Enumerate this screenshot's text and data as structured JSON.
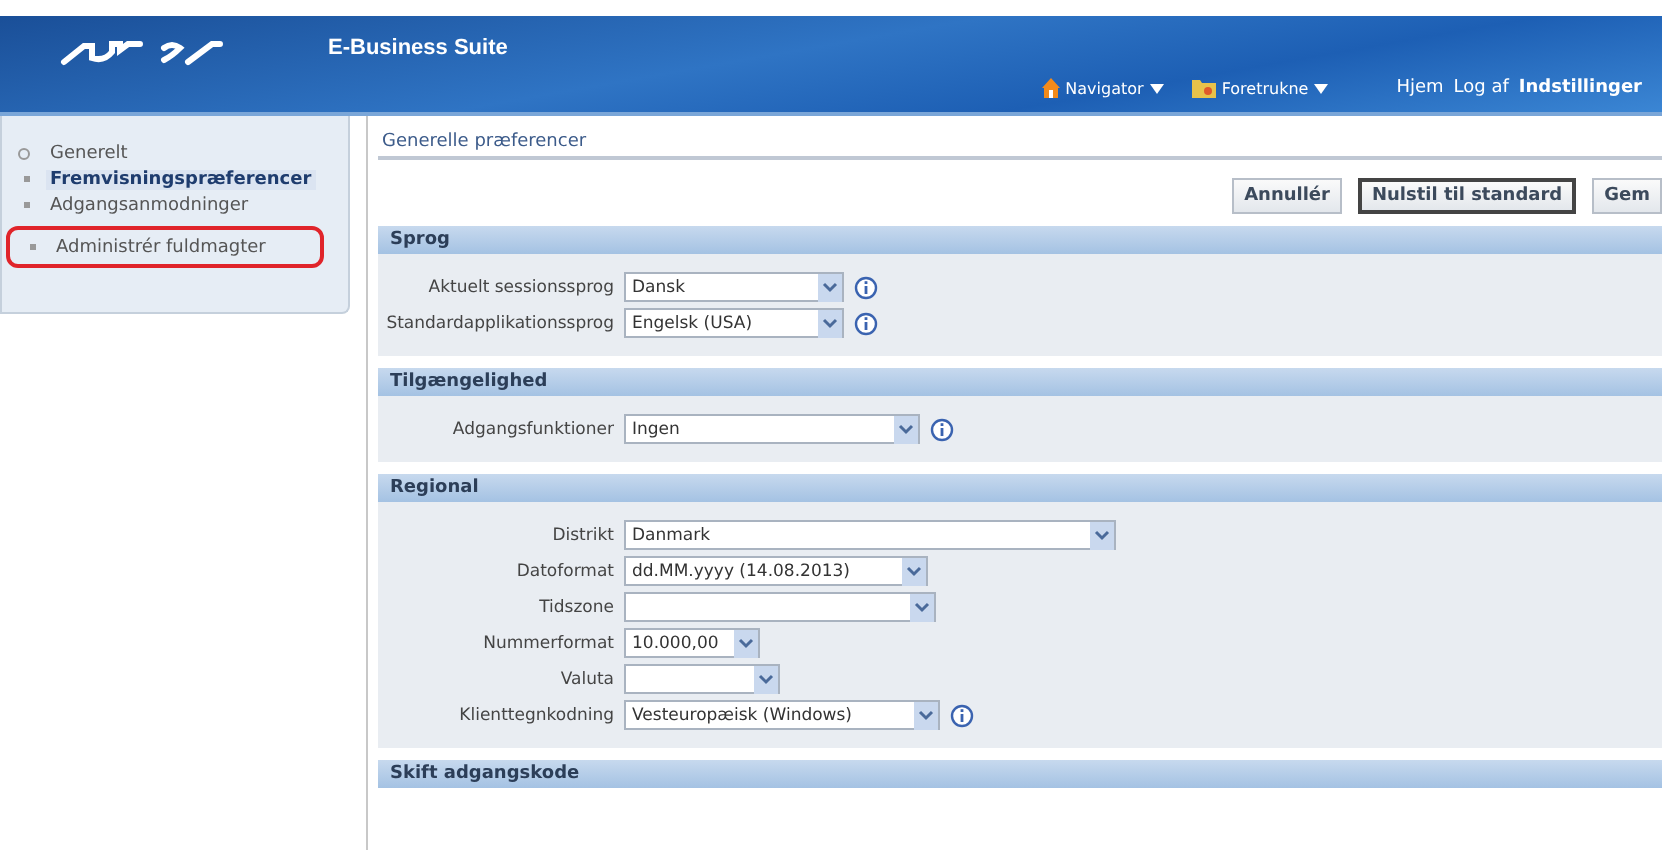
{
  "header": {
    "product": "E-Business Suite",
    "menus": [
      {
        "kind": "navigator",
        "label": "Navigator"
      },
      {
        "kind": "favorites",
        "label": "Foretrukne"
      }
    ],
    "links": [
      {
        "label": "Hjem",
        "bold": false
      },
      {
        "label": "Log af",
        "bold": false
      },
      {
        "label": "Indstillinger",
        "bold": true
      }
    ]
  },
  "sidebar": {
    "items": [
      {
        "label": "Generelt",
        "selected": false,
        "annotated": false,
        "children": [
          {
            "label": "Fremvisningspræferencer",
            "selected": true,
            "annotated": false
          },
          {
            "label": "Adgangsanmodninger",
            "selected": false,
            "annotated": false
          },
          {
            "label": "Administrér fuldmagter",
            "selected": false,
            "annotated": true
          }
        ]
      }
    ]
  },
  "page_title": "Generelle præferencer",
  "buttons": [
    {
      "label": "Annullér",
      "focused": false
    },
    {
      "label": "Nulstil til standard",
      "focused": true
    },
    {
      "label": "Gem",
      "focused": false
    }
  ],
  "sections": [
    {
      "title": "Sprog",
      "fields": [
        {
          "label": "Aktuelt sessionssprog",
          "value": "Dansk",
          "info": true
        },
        {
          "label": "Standardapplikationssprog",
          "value": "Engelsk (USA)",
          "info": true
        }
      ]
    },
    {
      "title": "Tilgængelighed",
      "fields": [
        {
          "label": "Adgangsfunktioner",
          "value": "Ingen",
          "info": true
        }
      ]
    },
    {
      "title": "Regional",
      "fields": [
        {
          "label": "Distrikt",
          "value": "Danmark",
          "info": false
        },
        {
          "label": "Datoformat",
          "value": "dd.MM.yyyy (14.08.2013)",
          "info": false
        },
        {
          "label": "Tidszone",
          "info": false
        },
        {
          "label": "Nummerformat",
          "value": "10.000,00",
          "info": false
        },
        {
          "label": "Valuta",
          "info": false
        },
        {
          "label": "Klienttegnkodning",
          "value": "Vesteuropæisk (Windows)",
          "info": true
        }
      ]
    },
    {
      "title": "Skift adgangskode"
    }
  ]
}
